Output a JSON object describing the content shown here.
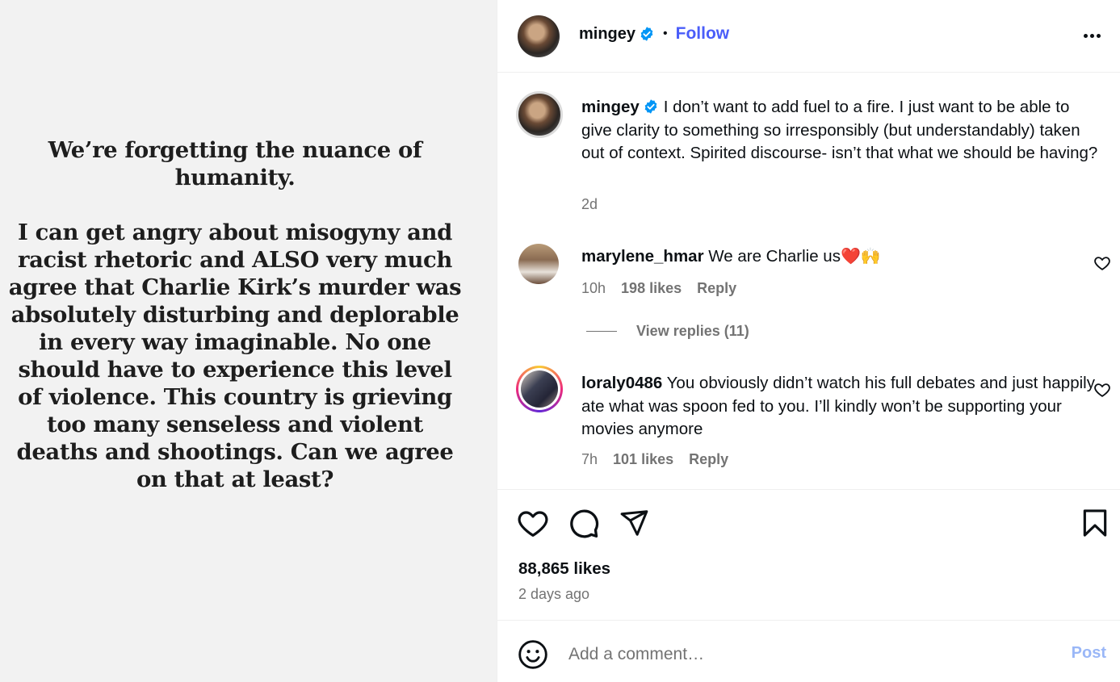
{
  "image_text": {
    "para1": "We’re forgetting the nuance of humanity.",
    "para2": "I can get angry about misogyny and racist rhetoric and ALSO very much agree that Charlie Kirk’s murder was absolutely disturbing and deplorable in every way imaginable. No one should have to experience this level of violence. This country is grieving too many senseless and violent deaths and shootings. Can we agree on that at least?"
  },
  "header": {
    "username": "mingey",
    "separator": "•",
    "follow_label": "Follow"
  },
  "caption": {
    "username": "mingey",
    "text": "I don’t want to add fuel to a fire. I just want to be able to give clarity to something so irresponsibly (but understandably) taken out of context. Spirited discourse- isn’t that what we should be having?",
    "time": "2d"
  },
  "comments": [
    {
      "username": "marylene_hmar",
      "text": "We are Charlie us",
      "emojis": "❤️🙌",
      "time": "10h",
      "likes": "198 likes",
      "reply_label": "Reply",
      "view_replies": "View replies (11)"
    },
    {
      "username": "loraly0486",
      "text": "You obviously didn’t watch his full debates and just happily ate what was spoon fed to you. I’ll kindly won’t be supporting your movies anymore",
      "time": "7h",
      "likes": "101 likes",
      "reply_label": "Reply"
    }
  ],
  "post": {
    "likes": "88,865 likes",
    "time_ago": "2 days ago"
  },
  "add_comment": {
    "placeholder": "Add a comment…",
    "post_label": "Post"
  },
  "icons": {
    "verified": "verified-badge-icon",
    "more": "more-options-icon",
    "like": "heart-icon",
    "comment": "comment-icon",
    "share": "share-icon",
    "save": "bookmark-icon",
    "emoji": "emoji-icon"
  },
  "colors": {
    "link": "#4a5df9",
    "verified": "#0095f6",
    "muted": "#737373",
    "post_disabled": "#9ab7f7"
  }
}
